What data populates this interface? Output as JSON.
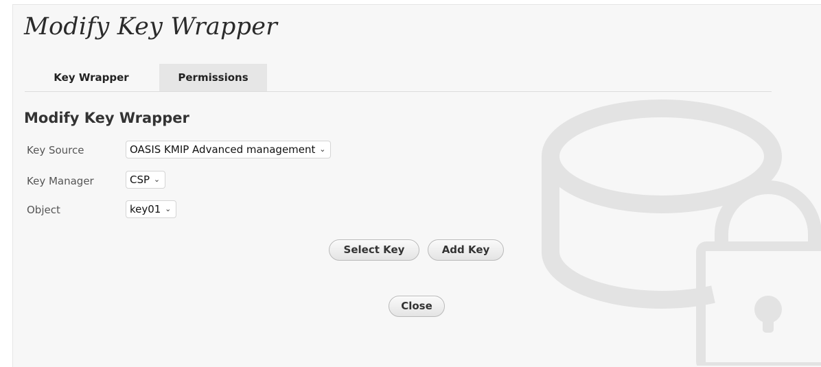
{
  "window": {
    "title": "Modify Key Wrapper"
  },
  "tabs": [
    {
      "label": "Key Wrapper",
      "active": true
    },
    {
      "label": "Permissions",
      "active": false
    }
  ],
  "section": {
    "title": "Modify Key Wrapper"
  },
  "form": {
    "key_source": {
      "label": "Key Source",
      "value": "OASIS KMIP Advanced management"
    },
    "key_manager": {
      "label": "Key Manager",
      "value": "CSP"
    },
    "object": {
      "label": "Object",
      "value": "key01"
    }
  },
  "buttons": {
    "select_key": "Select Key",
    "add_key": "Add Key",
    "close": "Close"
  },
  "icons": {
    "dropdown": "chevron-down-icon",
    "background": "database-lock-icon"
  },
  "colors": {
    "background": "#f7f7f7",
    "inactive_tab": "#e6e6e6",
    "illustration": "#e3e3e3"
  }
}
